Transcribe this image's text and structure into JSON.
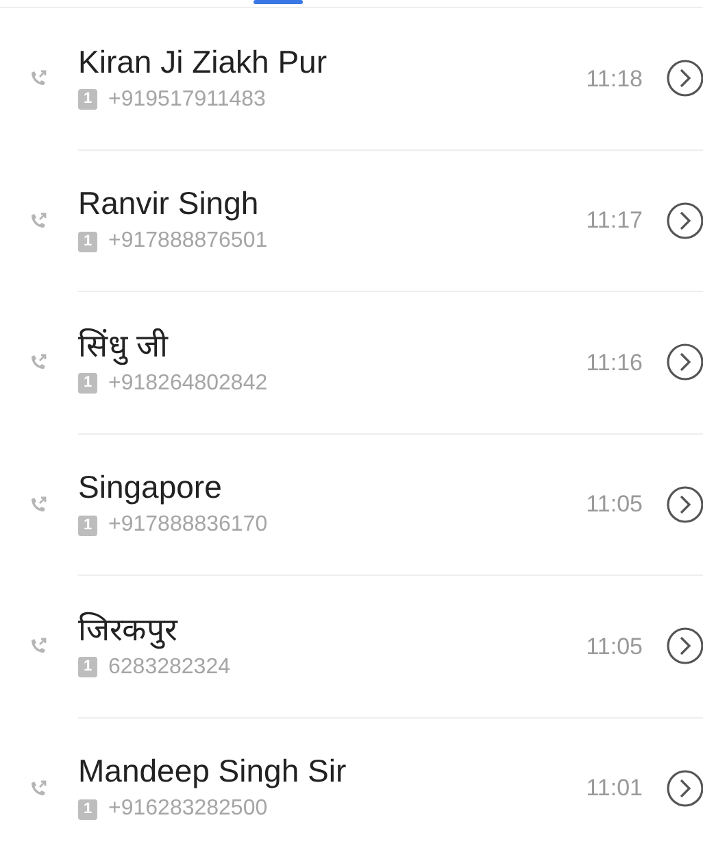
{
  "tabs_indicator": {
    "selected": true
  },
  "calls": [
    {
      "name": "Kiran Ji Ziakh Pur",
      "sim": "1",
      "number": "+919517911483",
      "time": "11:18"
    },
    {
      "name": "Ranvir Singh",
      "sim": "1",
      "number": "+917888876501",
      "time": "11:17"
    },
    {
      "name": "सिंधु जी",
      "sim": "1",
      "number": "+918264802842",
      "time": "11:16"
    },
    {
      "name": "Singapore",
      "sim": "1",
      "number": "+917888836170",
      "time": "11:05"
    },
    {
      "name": "जिरकपुर",
      "sim": "1",
      "number": "6283282324",
      "time": "11:05"
    },
    {
      "name": "Mandeep Singh Sir",
      "sim": "1",
      "number": "+916283282500",
      "time": "11:01"
    }
  ]
}
